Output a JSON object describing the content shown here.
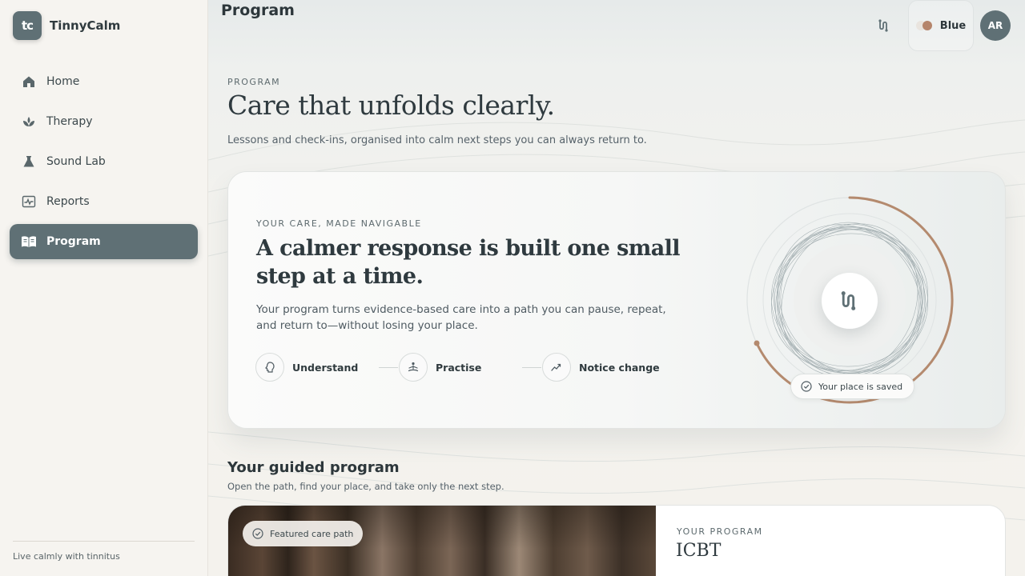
{
  "brand": {
    "logo_text": "tc",
    "name": "TinnyCalm"
  },
  "sidebar": {
    "items": [
      {
        "label": "Home",
        "icon": "home-icon",
        "active": false
      },
      {
        "label": "Therapy",
        "icon": "lotus-icon",
        "active": false
      },
      {
        "label": "Sound Lab",
        "icon": "flask-icon",
        "active": false
      },
      {
        "label": "Reports",
        "icon": "chart-icon",
        "active": false
      },
      {
        "label": "Program",
        "icon": "book-icon",
        "active": true
      }
    ],
    "footer": "Live calmly with tinnitus"
  },
  "header": {
    "title": "Program",
    "theme_label": "Blue",
    "avatar_initials": "AR"
  },
  "hero": {
    "eyebrow": "PROGRAM",
    "title": "Care that unfolds clearly.",
    "subtitle": "Lessons and check-ins, organised into calm next steps you can always return to."
  },
  "care_card": {
    "eyebrow": "YOUR CARE, MADE NAVIGABLE",
    "title": "A calmer response is built one small step at a time.",
    "body": "Your program turns evidence-based care into a path you can pause, repeat, and return to—without losing your place.",
    "steps": [
      "Understand",
      "Practise",
      "Notice change"
    ],
    "saved_label": "Your place is saved"
  },
  "guided": {
    "title": "Your guided program",
    "subtitle": "Open the path, find your place, and take only the next step.",
    "featured_label": "Featured care path",
    "program_eyebrow": "YOUR PROGRAM",
    "program_name": "ICBT"
  },
  "colors": {
    "accent": "#5f7075",
    "ring_progress": "#b48a6e",
    "theme_dot_left": "#e9e4de",
    "theme_dot_right": "#b5856b"
  }
}
